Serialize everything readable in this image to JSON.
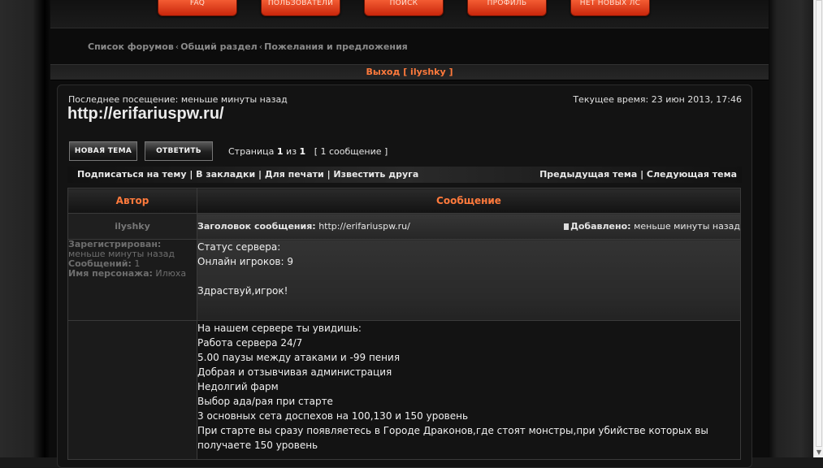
{
  "topnav": [
    "FAQ",
    "ПОЛЬЗОВАТЕЛИ",
    "ПОИСК",
    "ПРОФИЛЬ",
    "НЕТ НОВЫХ ЛС"
  ],
  "breadcrumb": [
    "Список форумов",
    "Общий раздел",
    "Пожелания и предложения"
  ],
  "logout": "Выход [ ilyshky ]",
  "last_visit": "Последнее посещение: меньше минуты назад",
  "current_time": "Текущее время: 23 июн 2013, 17:46",
  "site_title": "http://erifariuspw.ru/",
  "buttons": {
    "new_topic": "НОВАЯ ТЕМА",
    "reply": "ОТВЕТИТЬ"
  },
  "pagination": {
    "prefix": "Страница",
    "page": "1",
    "of": "из",
    "total": "1",
    "count": "[ 1 сообщение ]"
  },
  "actions_left": "Подписаться на тему | В закладки | Для печати | Известить друга",
  "actions_right": "Предыдущая тема | Следующая тема",
  "table": {
    "author_header": "Автор",
    "message_header": "Сообщение"
  },
  "post": {
    "author": "ilyshky",
    "subject_label": "Заголовок сообщения:",
    "subject": "http://erifariuspw.ru/",
    "added_label": "Добавлено:",
    "added": "меньше минуты назад",
    "registered_label": "Зарегистрирован:",
    "registered": "меньше минуты назад",
    "posts_label": "Сообщений:",
    "posts": "1",
    "character_label": "Имя персонажа:",
    "character": "Илюха",
    "body1": [
      "Статус сервера:",
      "Онлайн игроков: 9",
      "",
      "Здраствуй,игрок!"
    ],
    "body2": [
      "На нашем сервере ты увидишь:",
      "Работа сервера 24/7",
      "5.00 паузы между атаками и -99 пения",
      "Добрая и отзывчивая администрация",
      "Недолгий фарм",
      "Выбор ада/рая при старте",
      "3 основных сета доспехов на 100,130 и 150 уровень",
      "При старте вы сразу появляетесь в Городе Драконов,где стоят монстры,при убийстве которых вы",
      "получаете 150 уровень"
    ]
  },
  "colors": {
    "accent": "#ff7a3c",
    "nav_button": "#e8431a"
  }
}
